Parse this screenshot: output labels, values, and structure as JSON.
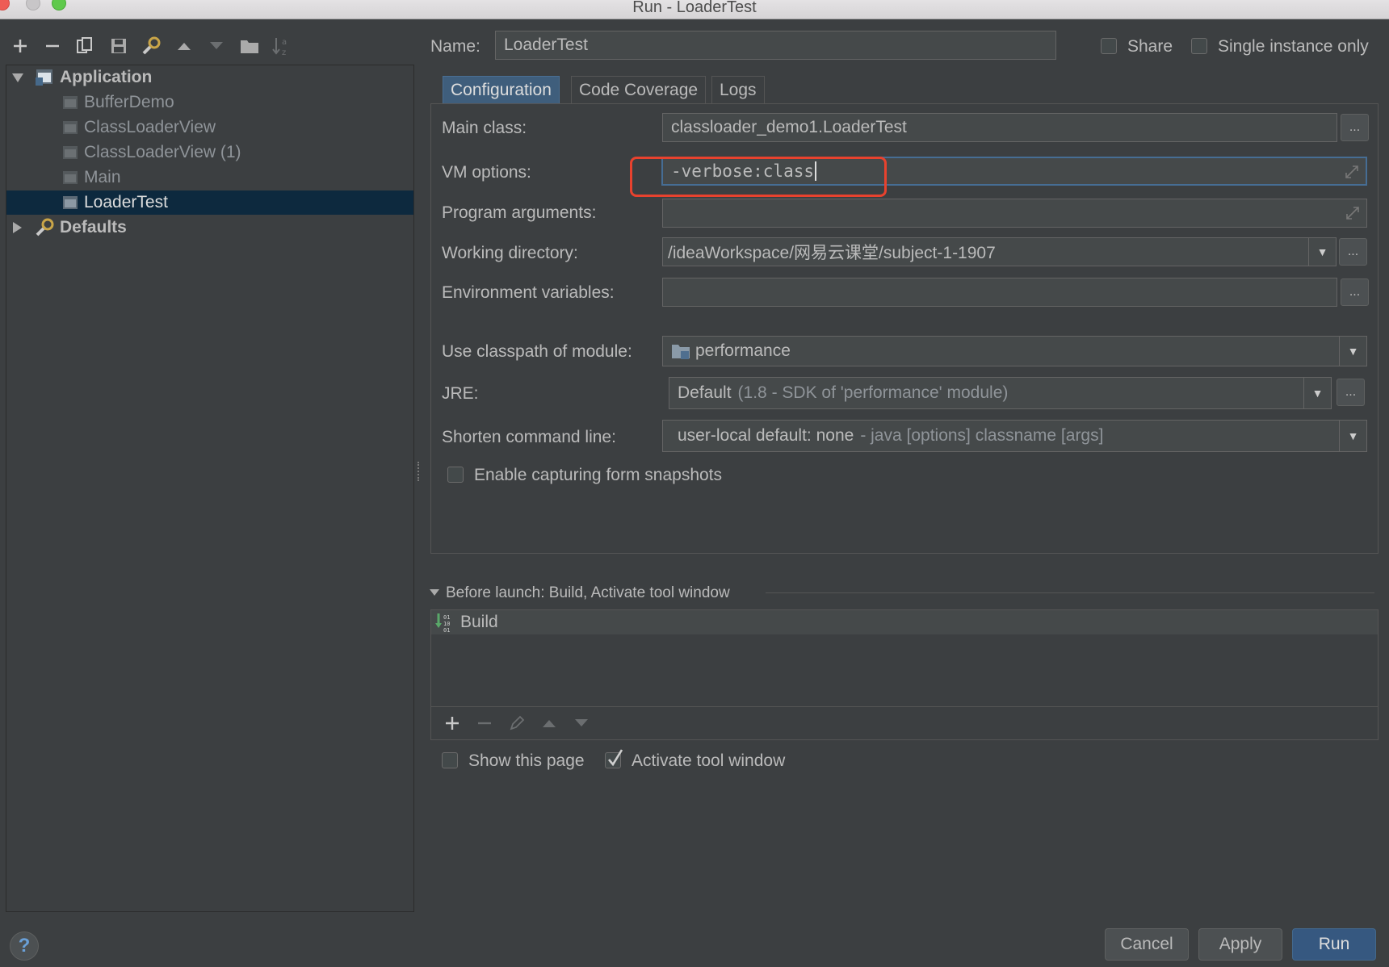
{
  "window": {
    "title": "Run - LoaderTest"
  },
  "tree": {
    "application": "Application",
    "items": [
      "BufferDemo",
      "ClassLoaderView",
      "ClassLoaderView (1)",
      "Main",
      "LoaderTest"
    ],
    "defaults": "Defaults"
  },
  "header": {
    "name_label": "Name:",
    "name_value": "LoaderTest",
    "share_label": "Share",
    "single_instance_label": "Single instance only"
  },
  "tabs": [
    "Configuration",
    "Code Coverage",
    "Logs"
  ],
  "config": {
    "main_class_label": "Main class:",
    "main_class_value": "classloader_demo1.LoaderTest",
    "vm_options_label": "VM options:",
    "vm_options_value": "-verbose:class",
    "program_args_label": "Program arguments:",
    "program_args_value": "",
    "working_dir_label": "Working directory:",
    "working_dir_value": "/ideaWorkspace/网易云课堂/subject-1-1907",
    "env_vars_label": "Environment variables:",
    "env_vars_value": "",
    "classpath_label": "Use classpath of module:",
    "classpath_value": "performance",
    "jre_label": "JRE:",
    "jre_value": "Default",
    "jre_hint": "(1.8 - SDK of 'performance' module)",
    "shorten_label": "Shorten command line:",
    "shorten_value": "user-local default: none",
    "shorten_hint": "- java [options] classname [args]",
    "snapshots_label": "Enable capturing form snapshots",
    "ellipsis": "..."
  },
  "before_launch": {
    "header": "Before launch: Build, Activate tool window",
    "items": [
      "Build"
    ],
    "show_page_label": "Show this page",
    "activate_label": "Activate tool window"
  },
  "buttons": {
    "cancel": "Cancel",
    "apply": "Apply",
    "run": "Run",
    "help": "?"
  },
  "colors": {
    "background": "#3c3f41",
    "selection": "#0d293e",
    "highlight_box": "#e8422e",
    "default_button": "#365880"
  }
}
